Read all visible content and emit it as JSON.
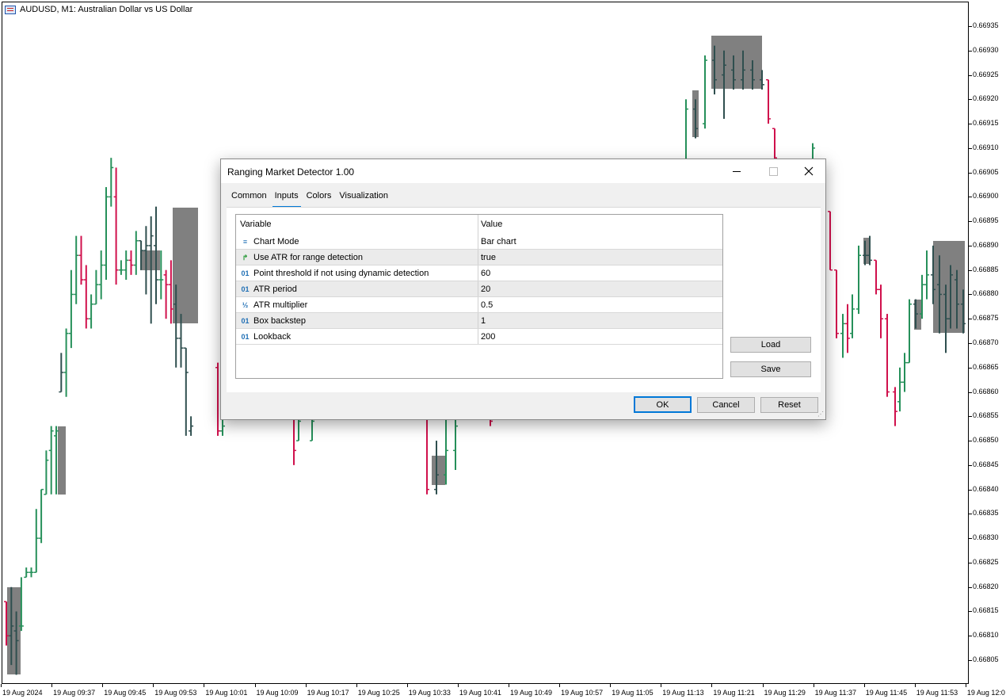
{
  "window": {
    "title": "AUDUSD, M1:  Australian Dollar vs US Dollar",
    "icon": "chart-window-icon"
  },
  "chart_data": {
    "type": "bar",
    "symbol": "AUDUSD",
    "timeframe": "M1",
    "y_ticks": [
      "0.66935",
      "0.66930",
      "0.66925",
      "0.66920",
      "0.66915",
      "0.66910",
      "0.66905",
      "0.66900",
      "0.66895",
      "0.66890",
      "0.66885",
      "0.66880",
      "0.66875",
      "0.66870",
      "0.66865",
      "0.66860",
      "0.66855",
      "0.66850",
      "0.66845",
      "0.66840",
      "0.66835",
      "0.66830",
      "0.66825",
      "0.66820",
      "0.66815",
      "0.66810",
      "0.66805"
    ],
    "ylim": [
      0.668025,
      0.66939
    ],
    "x_ticks": [
      "19 Aug 2024",
      "19 Aug 09:37",
      "19 Aug 09:45",
      "19 Aug 09:53",
      "19 Aug 10:01",
      "19 Aug 10:09",
      "19 Aug 10:17",
      "19 Aug 10:25",
      "19 Aug 10:33",
      "19 Aug 10:41",
      "19 Aug 10:49",
      "19 Aug 10:57",
      "19 Aug 11:05",
      "19 Aug 11:13",
      "19 Aug 11:21",
      "19 Aug 11:29",
      "19 Aug 11:37",
      "19 Aug 11:45",
      "19 Aug 11:53",
      "19 Aug 12:0"
    ],
    "colors": {
      "bull": "#26905a",
      "bear": "#d0104c",
      "range_bar": "#2f4f4f",
      "range_box": "#808080"
    },
    "bars": [
      {
        "i": 0,
        "o": 0.66817,
        "h": 0.66817,
        "l": 0.66808,
        "c": 0.6681
      },
      {
        "i": 1,
        "o": 0.6681,
        "h": 0.6682,
        "l": 0.66804,
        "c": 0.66812
      },
      {
        "i": 2,
        "o": 0.66811,
        "h": 0.66815,
        "l": 0.66802,
        "c": 0.66809
      },
      {
        "i": 3,
        "o": 0.66812,
        "h": 0.66822,
        "l": 0.66811,
        "c": 0.66812
      },
      {
        "i": 4,
        "o": 0.66822,
        "h": 0.66824,
        "l": 0.66822,
        "c": 0.66823
      },
      {
        "i": 5,
        "o": 0.66823,
        "h": 0.66824,
        "l": 0.66822,
        "c": 0.66823
      },
      {
        "i": 6,
        "o": 0.66823,
        "h": 0.66836,
        "l": 0.66823,
        "c": 0.6683
      },
      {
        "i": 7,
        "o": 0.6683,
        "h": 0.6684,
        "l": 0.66829,
        "c": 0.6684
      },
      {
        "i": 8,
        "o": 0.66839,
        "h": 0.66848,
        "l": 0.66839,
        "c": 0.66846
      },
      {
        "i": 9,
        "o": 0.66848,
        "h": 0.66853,
        "l": 0.66839,
        "c": 0.66852
      },
      {
        "i": 10,
        "o": 0.66851,
        "h": 0.66853,
        "l": 0.66839,
        "c": 0.66852
      },
      {
        "i": 11,
        "o": 0.6686,
        "h": 0.66868,
        "l": 0.6686,
        "c": 0.66864
      },
      {
        "i": 12,
        "o": 0.66864,
        "h": 0.66873,
        "l": 0.66859,
        "c": 0.66872
      },
      {
        "i": 13,
        "o": 0.66872,
        "h": 0.66885,
        "l": 0.66869,
        "c": 0.6688
      },
      {
        "i": 14,
        "o": 0.6688,
        "h": 0.66892,
        "l": 0.66878,
        "c": 0.66888
      },
      {
        "i": 15,
        "o": 0.66888,
        "h": 0.66892,
        "l": 0.66882,
        "c": 0.66883
      },
      {
        "i": 16,
        "o": 0.66883,
        "h": 0.66886,
        "l": 0.66873,
        "c": 0.66875
      },
      {
        "i": 17,
        "o": 0.66875,
        "h": 0.6688,
        "l": 0.66873,
        "c": 0.66878
      },
      {
        "i": 18,
        "o": 0.66878,
        "h": 0.66885,
        "l": 0.66878,
        "c": 0.66882
      },
      {
        "i": 19,
        "o": 0.66882,
        "h": 0.66889,
        "l": 0.66879,
        "c": 0.66886
      },
      {
        "i": 20,
        "o": 0.66886,
        "h": 0.66902,
        "l": 0.66883,
        "c": 0.669
      },
      {
        "i": 21,
        "o": 0.669,
        "h": 0.66908,
        "l": 0.66898,
        "c": 0.66906
      },
      {
        "i": 22,
        "o": 0.669,
        "h": 0.66906,
        "l": 0.66882,
        "c": 0.66885
      },
      {
        "i": 23,
        "o": 0.66885,
        "h": 0.66887,
        "l": 0.66884,
        "c": 0.66885
      },
      {
        "i": 24,
        "o": 0.66885,
        "h": 0.66889,
        "l": 0.66883,
        "c": 0.66887
      },
      {
        "i": 25,
        "o": 0.66887,
        "h": 0.66889,
        "l": 0.66884,
        "c": 0.66886
      },
      {
        "i": 26,
        "o": 0.66886,
        "h": 0.66893,
        "l": 0.66884,
        "c": 0.66891
      },
      {
        "i": 27,
        "o": 0.66891,
        "h": 0.66891,
        "l": 0.66885,
        "c": 0.66889
      },
      {
        "i": 28,
        "o": 0.66889,
        "h": 0.66894,
        "l": 0.6688,
        "c": 0.6689
      },
      {
        "i": 29,
        "o": 0.6689,
        "h": 0.66896,
        "l": 0.66874,
        "c": 0.66892
      },
      {
        "i": 30,
        "o": 0.6689,
        "h": 0.66898,
        "l": 0.66878,
        "c": 0.66883
      },
      {
        "i": 31,
        "o": 0.66883,
        "h": 0.66889,
        "l": 0.66879,
        "c": 0.66883
      },
      {
        "i": 32,
        "o": 0.66884,
        "h": 0.66885,
        "l": 0.66875,
        "c": 0.66882
      },
      {
        "i": 33,
        "o": 0.66882,
        "h": 0.66887,
        "l": 0.66874,
        "c": 0.66877
      },
      {
        "i": 34,
        "o": 0.66878,
        "h": 0.66882,
        "l": 0.66865,
        "c": 0.66871
      },
      {
        "i": 35,
        "o": 0.66871,
        "h": 0.66876,
        "l": 0.66865,
        "c": 0.66869
      },
      {
        "i": 36,
        "o": 0.66869,
        "h": 0.66869,
        "l": 0.66851,
        "c": 0.66864
      },
      {
        "i": 37,
        "o": 0.66852,
        "h": 0.66855,
        "l": 0.66851,
        "c": 0.66853
      }
    ],
    "right_bars": [
      {
        "i": 0,
        "o": 0.66922,
        "h": 0.66922,
        "l": 0.66908,
        "c": 0.66912
      },
      {
        "i": 1,
        "o": 0.66912,
        "h": 0.66915,
        "l": 0.66905,
        "c": 0.66908
      },
      {
        "i": 2,
        "o": 0.66905,
        "h": 0.6691,
        "l": 0.66902,
        "c": 0.66907
      }
    ]
  },
  "dialog": {
    "title": "Ranging Market Detector 1.00",
    "tabs": [
      {
        "label": "Common"
      },
      {
        "label": "Inputs"
      },
      {
        "label": "Colors"
      },
      {
        "label": "Visualization"
      }
    ],
    "active_tab": "Inputs",
    "columns": {
      "variable": "Variable",
      "value": "Value"
    },
    "rows": [
      {
        "type_icon": "enum-icon",
        "variable": "Chart Mode",
        "value": "Bar chart"
      },
      {
        "type_icon": "bool-icon",
        "variable": "Use ATR for range detection",
        "value": "true"
      },
      {
        "type_icon": "int-icon",
        "variable": "Point threshold if not using dynamic detection",
        "value": "60"
      },
      {
        "type_icon": "int-icon",
        "variable": "ATR period",
        "value": "20"
      },
      {
        "type_icon": "double-icon",
        "variable": "ATR multiplier",
        "value": "0.5"
      },
      {
        "type_icon": "int-icon",
        "variable": "Box backstep",
        "value": "1"
      },
      {
        "type_icon": "int-icon",
        "variable": "Lookback",
        "value": "200"
      }
    ],
    "buttons": {
      "load": "Load",
      "save": "Save",
      "ok": "OK",
      "cancel": "Cancel",
      "reset": "Reset"
    },
    "icon_glyphs": {
      "enum": "≡",
      "bool": "↱",
      "int": "01",
      "double": "½"
    }
  }
}
